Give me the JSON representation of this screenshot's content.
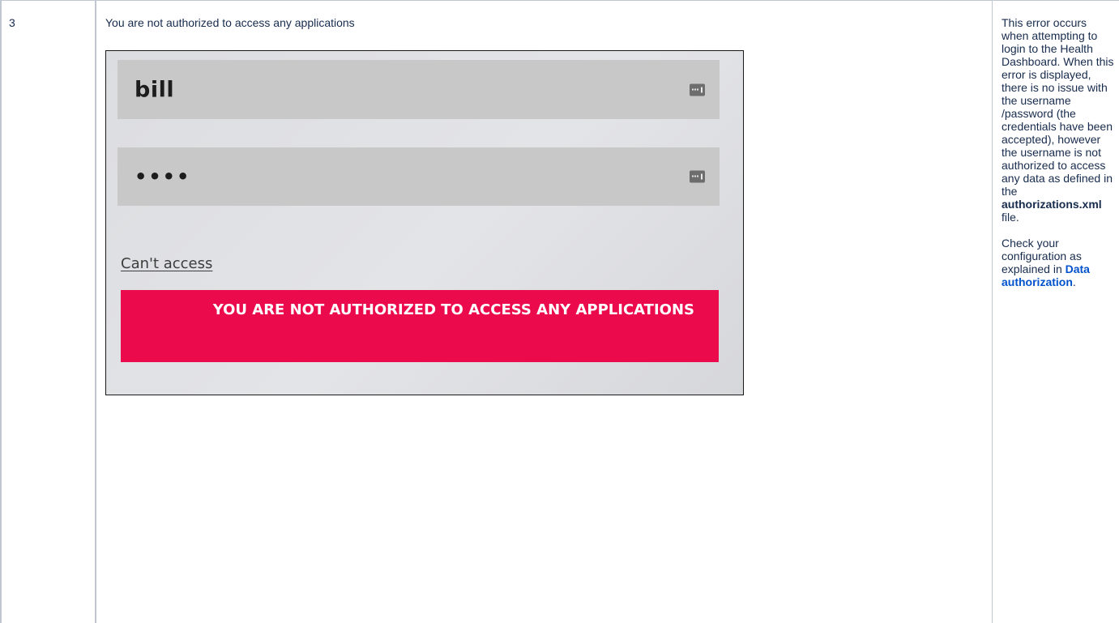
{
  "row": {
    "number": "3",
    "title": "You are not authorized to access any applications"
  },
  "screenshot": {
    "username_value": "bill",
    "password_value": "••••",
    "username_icon": "password-manager-key-icon",
    "password_icon": "password-manager-key-icon",
    "cant_access_link": "Can't access",
    "error_message": "YOU ARE NOT AUTHORIZED TO ACCESS ANY APPLICATIONS",
    "error_color": "#eb0a4b",
    "field_color": "#c8c8c8"
  },
  "notes": {
    "p1_text1": "This error occurs when attempting to login to the Health Dashboard. When this error is displayed, there is no issue with the username /password (the credentials have been accepted), however the username is not authorized to access any data as defined in the ",
    "p1_bold": "authorizations.xml",
    "p1_text2": " file.",
    "p2_text1": "Check your configuration as explained in ",
    "p2_link": "Data authorization",
    "p2_text2": ".",
    "link_color": "#0052cc"
  }
}
